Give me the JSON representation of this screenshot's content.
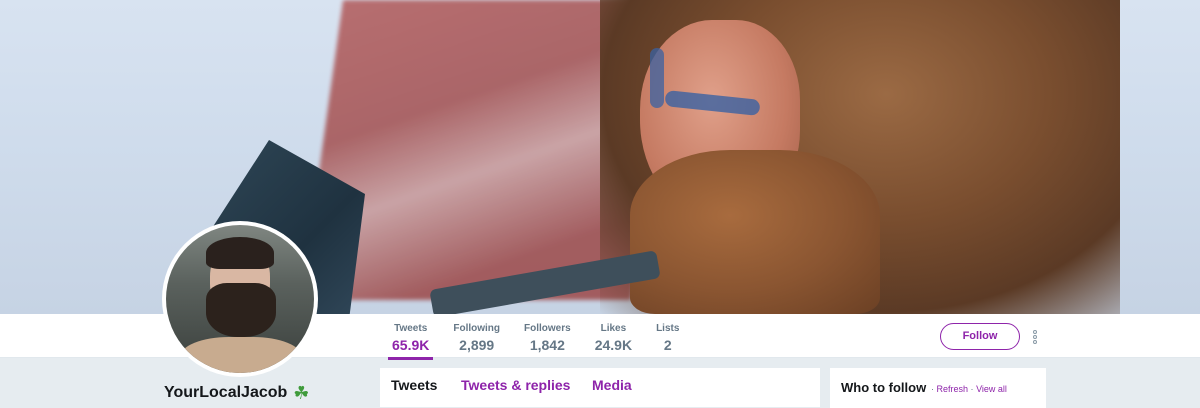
{
  "profile": {
    "display_name": "YourLocalJacob",
    "name_emoji": "☘"
  },
  "stats": [
    {
      "label": "Tweets",
      "value": "65.9K",
      "active": true
    },
    {
      "label": "Following",
      "value": "2,899",
      "active": false
    },
    {
      "label": "Followers",
      "value": "1,842",
      "active": false
    },
    {
      "label": "Likes",
      "value": "24.9K",
      "active": false
    },
    {
      "label": "Lists",
      "value": "2",
      "active": false
    }
  ],
  "actions": {
    "follow_label": "Follow",
    "more_icon": "more-vertical-icon"
  },
  "tabs": [
    {
      "label": "Tweets"
    },
    {
      "label": "Tweets & replies"
    },
    {
      "label": "Media"
    }
  ],
  "who_to_follow": {
    "title": "Who to follow",
    "separator": "·",
    "refresh": "Refresh",
    "view_all": "View all"
  },
  "colors": {
    "accent": "#8e24aa",
    "text_primary": "#14171a",
    "text_secondary": "#657786",
    "background": "#e6ecf0"
  }
}
